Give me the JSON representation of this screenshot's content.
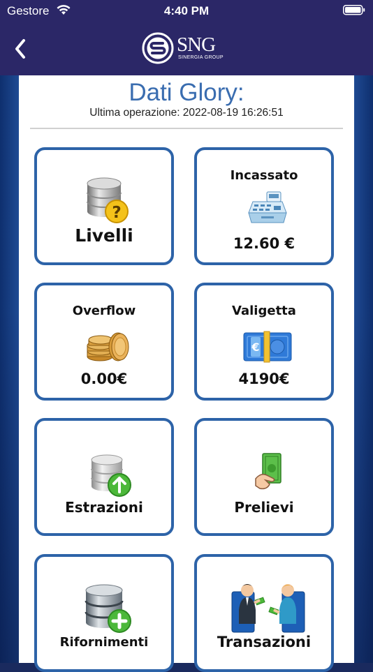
{
  "status_bar": {
    "carrier": "Gestore",
    "time": "4:40 PM"
  },
  "nav": {
    "logo_text": "SNG",
    "logo_subtext": "SINERGIA GROUP"
  },
  "header": {
    "title": "Dati Glory:",
    "last_operation": "Ultima operazione: 2022-08-19 16:26:51"
  },
  "tiles": {
    "livelli": {
      "label": "Livelli",
      "icon": "database-question-icon"
    },
    "incassato": {
      "label": "Incassato",
      "value": "12.60 €",
      "icon": "cash-register-icon"
    },
    "overflow": {
      "label": "Overflow",
      "value": "0.00€",
      "icon": "coin-stack-icon"
    },
    "valigetta": {
      "label": "Valigetta",
      "value": "4190€",
      "icon": "euro-banknote-icon"
    },
    "estrazioni": {
      "label": "Estrazioni",
      "icon": "database-upload-icon"
    },
    "prelievi": {
      "label": "Prelievi",
      "icon": "hand-money-icon"
    },
    "rifornimenti": {
      "label": "Rifornimenti",
      "icon": "database-add-icon"
    },
    "transazioni": {
      "label": "Transazioni",
      "icon": "people-exchange-icon"
    }
  },
  "colors": {
    "nav_bg": "#2b2767",
    "card_border": "#2d63a8",
    "title_blue": "#3a6db0"
  }
}
